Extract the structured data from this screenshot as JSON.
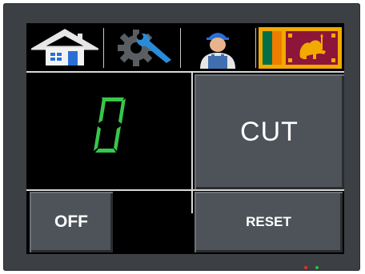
{
  "tabs": [
    {
      "name": "home",
      "icon": "home-icon"
    },
    {
      "name": "settings",
      "icon": "gear-wrench-icon"
    },
    {
      "name": "operator",
      "icon": "worker-icon"
    },
    {
      "name": "language",
      "icon": "sri-lanka-flag-icon"
    }
  ],
  "counter": {
    "value": "0",
    "color": "#37c74a"
  },
  "buttons": {
    "cut_label": "CUT",
    "off_label": "OFF",
    "reset_label": "RESET"
  },
  "colors": {
    "bezel": "#3c3f43",
    "screen": "#000000",
    "button": "#4d5358",
    "led_red": "#e0302a",
    "led_green": "#2fbf4a"
  }
}
